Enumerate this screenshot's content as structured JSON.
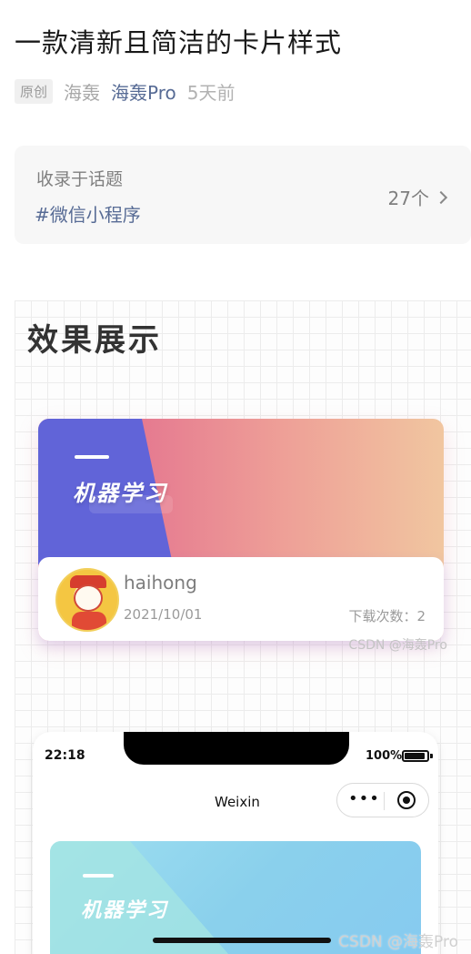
{
  "article": {
    "title": "一款清新且简洁的卡片样式",
    "badge": "原创",
    "author": "海轰",
    "author_link": "海轰Pro",
    "age": "5天前"
  },
  "topic": {
    "label": "收录于话题",
    "tag": "#微信小程序",
    "count": "27个"
  },
  "section": {
    "title": "效果展示"
  },
  "demo_card": {
    "title": "机器学习",
    "username": "haihong",
    "date": "2021/10/01",
    "downloads": "下载次数：2",
    "watermark": "CSDN @海轰Pro",
    "colors": {
      "left_block": "#6164d8",
      "gradient_start": "#e4748f",
      "gradient_end": "#f1c6a0"
    }
  },
  "phone": {
    "time": "22:18",
    "battery": "100%",
    "nav_title": "Weixin",
    "capsule_more": "•••",
    "card_title": "机器学习",
    "watermark": "CSDN @海轰Pro",
    "colors": {
      "card_start": "#9edff0",
      "card_end": "#86caf0"
    }
  },
  "icons": [
    "chevron-right-icon",
    "avatar-image",
    "more-dots-icon",
    "close-target-icon",
    "battery-icon"
  ]
}
